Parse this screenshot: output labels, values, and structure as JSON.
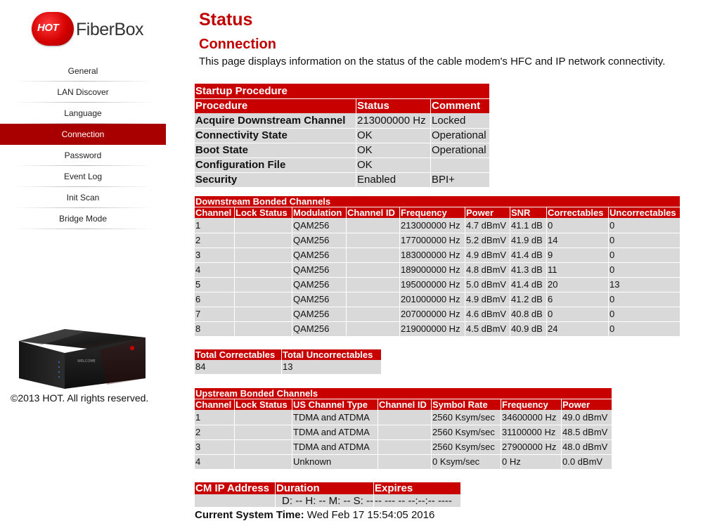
{
  "brand": {
    "logo_mark": "HOT",
    "logo_word": "FiberBox"
  },
  "nav": {
    "items": [
      {
        "label": "General"
      },
      {
        "label": "LAN Discover"
      },
      {
        "label": "Language"
      },
      {
        "label": "Connection",
        "active": true
      },
      {
        "label": "Password"
      },
      {
        "label": "Event Log"
      },
      {
        "label": "Init Scan"
      },
      {
        "label": "Bridge Mode"
      }
    ]
  },
  "device": {
    "screen_text": "WELCOME"
  },
  "footer": {
    "copyright": "©2013 HOT. All rights reserved."
  },
  "page": {
    "title": "Status",
    "subtitle": "Connection",
    "description": "This page displays information on the status of the cable modem's HFC and IP network connectivity."
  },
  "startup": {
    "title": "Startup Procedure",
    "headers": [
      "Procedure",
      "Status",
      "Comment"
    ],
    "rows": [
      [
        "Acquire Downstream Channel",
        "213000000 Hz",
        "Locked"
      ],
      [
        "Connectivity State",
        "OK",
        "Operational"
      ],
      [
        "Boot State",
        "OK",
        "Operational"
      ],
      [
        "Configuration File",
        "OK",
        ""
      ],
      [
        "Security",
        "Enabled",
        "BPI+"
      ]
    ]
  },
  "downstream": {
    "title": "Downstream Bonded Channels",
    "headers": [
      "Channel",
      "Lock Status",
      "Modulation",
      "Channel ID",
      "Frequency",
      "Power",
      "SNR",
      "Correctables",
      "Uncorrectables"
    ],
    "rows": [
      [
        "1",
        "",
        "QAM256",
        "",
        "213000000 Hz",
        "4.7 dBmV",
        "41.1 dB",
        "0",
        "0"
      ],
      [
        "2",
        "",
        "QAM256",
        "",
        "177000000 Hz",
        "5.2 dBmV",
        "41.9 dB",
        "14",
        "0"
      ],
      [
        "3",
        "",
        "QAM256",
        "",
        "183000000 Hz",
        "4.9 dBmV",
        "41.4 dB",
        "9",
        "0"
      ],
      [
        "4",
        "",
        "QAM256",
        "",
        "189000000 Hz",
        "4.8 dBmV",
        "41.3 dB",
        "11",
        "0"
      ],
      [
        "5",
        "",
        "QAM256",
        "",
        "195000000 Hz",
        "5.0 dBmV",
        "41.4 dB",
        "20",
        "13"
      ],
      [
        "6",
        "",
        "QAM256",
        "",
        "201000000 Hz",
        "4.9 dBmV",
        "41.2 dB",
        "6",
        "0"
      ],
      [
        "7",
        "",
        "QAM256",
        "",
        "207000000 Hz",
        "4.6 dBmV",
        "40.8 dB",
        "0",
        "0"
      ],
      [
        "8",
        "",
        "QAM256",
        "",
        "219000000 Hz",
        "4.5 dBmV",
        "40.9 dB",
        "24",
        "0"
      ]
    ]
  },
  "totals": {
    "headers": [
      "Total Correctables",
      "Total Uncorrectables"
    ],
    "values": [
      "84",
      "13"
    ]
  },
  "upstream": {
    "title": "Upstream Bonded Channels",
    "headers": [
      "Channel",
      "Lock Status",
      "US Channel Type",
      "Channel ID",
      "Symbol Rate",
      "Frequency",
      "Power"
    ],
    "rows": [
      [
        "1",
        "",
        "TDMA and ATDMA",
        "",
        "2560 Ksym/sec",
        "34600000 Hz",
        "49.0 dBmV"
      ],
      [
        "2",
        "",
        "TDMA and ATDMA",
        "",
        "2560 Ksym/sec",
        "31100000 Hz",
        "48.5 dBmV"
      ],
      [
        "3",
        "",
        "TDMA and ATDMA",
        "",
        "2560 Ksym/sec",
        "27900000 Hz",
        "48.0 dBmV"
      ],
      [
        "4",
        "",
        "Unknown",
        "",
        "0 Ksym/sec",
        "0 Hz",
        "0.0 dBmV"
      ]
    ]
  },
  "cmip": {
    "headers": [
      "CM IP Address",
      "Duration",
      "Expires"
    ],
    "values": [
      "",
      "D: -- H: -- M: -- S: --",
      "-- --- -- --:--:-- ----"
    ]
  },
  "systime": {
    "label": "Current System Time:",
    "value": "Wed Feb 17 15:54:05 2016"
  },
  "colors": {
    "accent": "#c80000",
    "nav_active": "#a80000",
    "cell": "#d9d9d9"
  }
}
